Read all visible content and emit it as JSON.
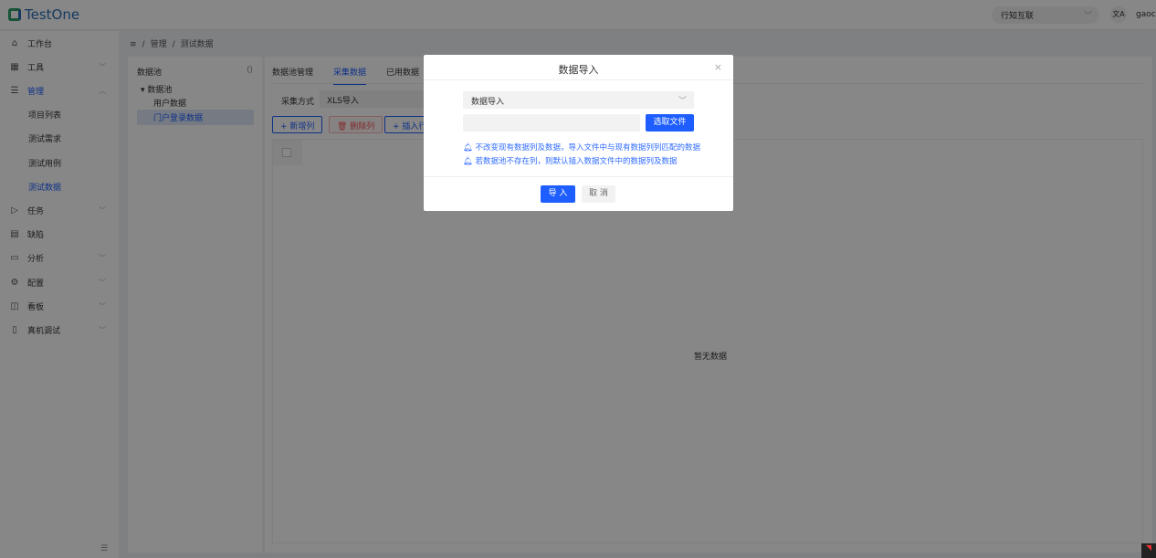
{
  "header": {
    "logo": "TestOne",
    "org": "行知互联",
    "lang_icon": "translate-icon",
    "user": "gaoc"
  },
  "sidebar": {
    "items": [
      {
        "label": "工作台",
        "icon": "⌂",
        "chev": ""
      },
      {
        "label": "工具",
        "icon": "▦",
        "chev": "﹀"
      },
      {
        "label": "管理",
        "icon": "☰",
        "chev": "︿"
      },
      {
        "label": "项目列表",
        "sub": true
      },
      {
        "label": "测试需求",
        "sub": true
      },
      {
        "label": "测试用例",
        "sub": true
      },
      {
        "label": "测试数据",
        "sub": true,
        "active": true
      },
      {
        "label": "任务",
        "icon": "▷",
        "chev": "﹀"
      },
      {
        "label": "缺陷",
        "icon": "▤",
        "chev": ""
      },
      {
        "label": "分析",
        "icon": "▭",
        "chev": "﹀"
      },
      {
        "label": "配置",
        "icon": "⚙",
        "chev": "﹀"
      },
      {
        "label": "看板",
        "icon": "◫",
        "chev": "﹀"
      },
      {
        "label": "真机调试",
        "icon": "▯",
        "chev": "﹀"
      }
    ]
  },
  "breadcrumb": {
    "menu": "≡",
    "level1": "管理",
    "sep": "/",
    "level2": "测试数据"
  },
  "tree": {
    "title": "数据池",
    "refresh": "⟨⟩",
    "root": "数据池",
    "children": [
      "用户数据",
      "门户登录数据"
    ]
  },
  "main": {
    "tabs": [
      "数据池管理",
      "采集数据",
      "已用数据"
    ],
    "mode_label": "采集方式",
    "mode_value": "XLS导入",
    "buttons": {
      "add_col": "+ 新增列",
      "del_col": "🗑 删除列",
      "insert_row": "+ 插入行"
    },
    "empty": "暂无数据"
  },
  "modal": {
    "title": "数据导入",
    "close": "×",
    "select_value": "数据导入",
    "pick_file": "选取文件",
    "tips": [
      "不改变现有数据列及数据，导入文件中与现有数据列列匹配的数据",
      "若数据池不存在列，则默认插入数据文件中的数据列及数据"
    ],
    "ok": "导 入",
    "cancel": "取 消"
  }
}
